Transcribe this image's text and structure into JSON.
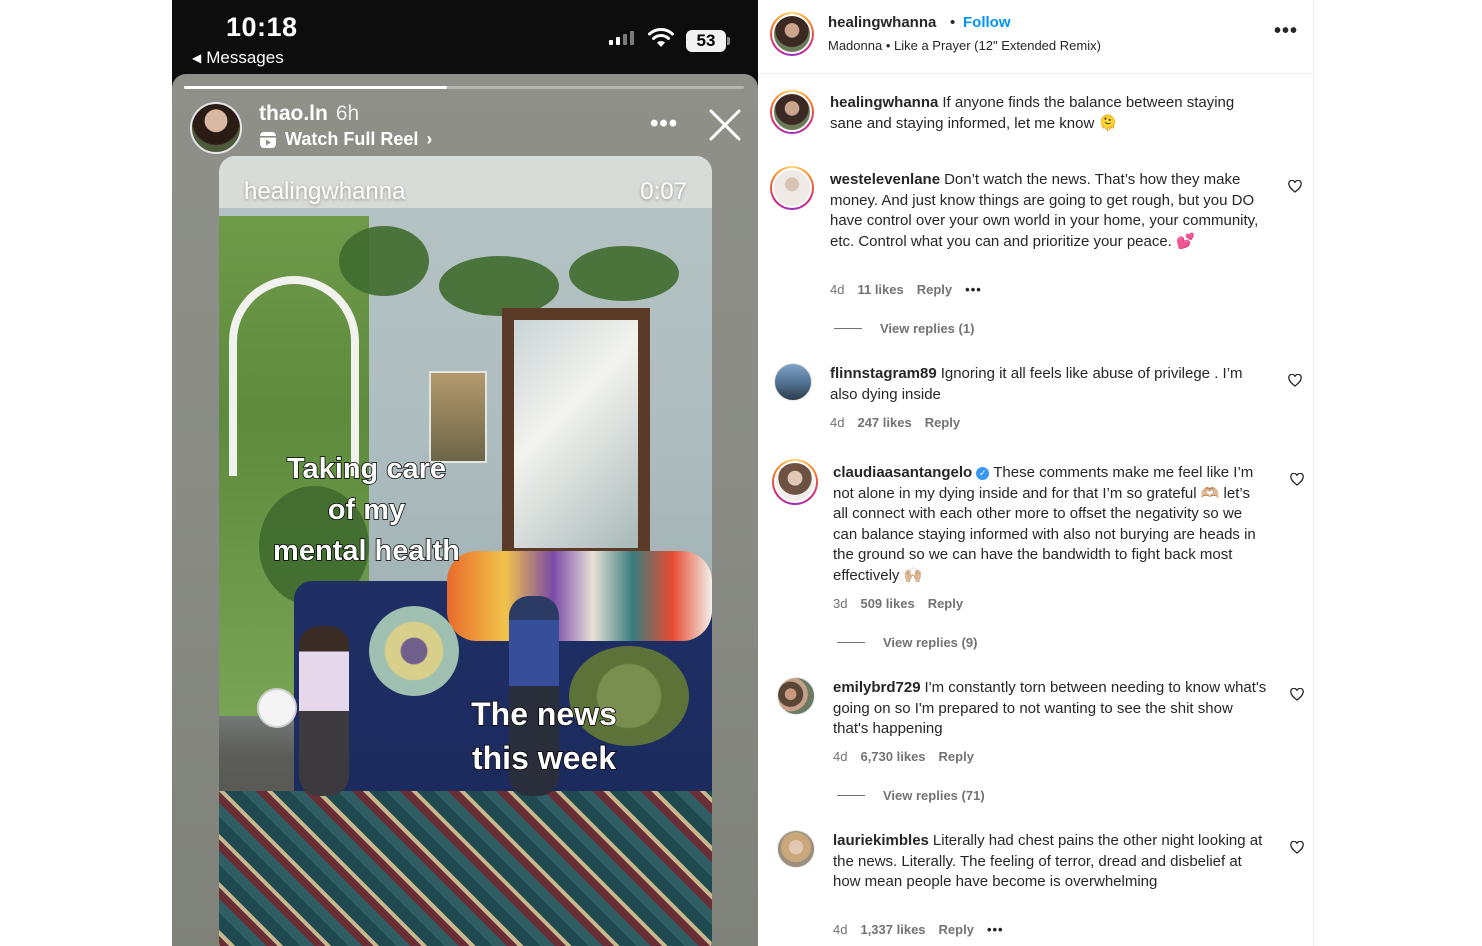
{
  "phone": {
    "status": {
      "time": "10:18",
      "back_label": "Messages",
      "battery": "53"
    },
    "story": {
      "username": "thao.ln",
      "age": "6h",
      "reel_link": "Watch Full Reel",
      "progress_fraction": 0.47,
      "video": {
        "username": "healingwhanna",
        "timestamp": "0:07",
        "caption_top": [
          "Taking care",
          "of my",
          "mental health"
        ],
        "caption_bottom": [
          "The news",
          "this week"
        ]
      }
    }
  },
  "post": {
    "header": {
      "username": "healingwhanna",
      "separator": "•",
      "follow_label": "Follow",
      "audio": "Madonna • Like a Prayer (12\" Extended Remix)"
    },
    "caption": {
      "username": "healingwhanna",
      "text": "If anyone finds the balance between staying sane and staying informed, let me know 🫠"
    },
    "comments": [
      {
        "username": "westelevenlane",
        "verified": false,
        "text": "Don’t watch the news. That’s how they make money. And just know things are going to get rough, but you DO have control over your own world in your home, your community, etc. Control what you can and prioritize your peace. 💕",
        "age": "4d",
        "likes": "11 likes",
        "reply": "Reply",
        "has_more": true,
        "view_replies": "View replies (1)"
      },
      {
        "username": "flinnstagram89",
        "verified": false,
        "text": "Ignoring it all feels like abuse of privilege . I’m also dying inside",
        "age": "4d",
        "likes": "247 likes",
        "reply": "Reply",
        "has_more": false,
        "view_replies": ""
      },
      {
        "username": "claudiaasantangelo",
        "verified": true,
        "text": "These comments make me feel like I’m not alone in my dying inside and for that I’m so grateful 🫶🏼 let’s all connect with each other more to offset the negativity so we can balance staying informed with also not burying are heads in the ground so we can have the bandwidth to fight back most effectively 🙌🏼",
        "age": "3d",
        "likes": "509 likes",
        "reply": "Reply",
        "has_more": false,
        "view_replies": "View replies (9)"
      },
      {
        "username": "emilybrd729",
        "verified": false,
        "text": "I'm constantly torn between needing to know what's going on so I'm prepared to not wanting to see the shit show that's happening",
        "age": "4d",
        "likes": "6,730 likes",
        "reply": "Reply",
        "has_more": false,
        "view_replies": "View replies (71)"
      },
      {
        "username": "lauriekimbles",
        "verified": false,
        "text": "Literally had chest pains the other night looking at the news. Literally. The feeling of terror, dread and disbelief at how mean people have become is overwhelming",
        "age": "4d",
        "likes": "1,337 likes",
        "reply": "Reply",
        "has_more": true,
        "view_replies": ""
      }
    ]
  },
  "colors": {
    "follow_blue": "#0095f6",
    "meta_gray": "#737373",
    "text_dark": "#262626"
  },
  "icons": [
    "signal-icon",
    "wifi-icon",
    "battery-icon",
    "reel-icon",
    "more-icon",
    "close-icon",
    "heart-icon",
    "verified-icon"
  ]
}
